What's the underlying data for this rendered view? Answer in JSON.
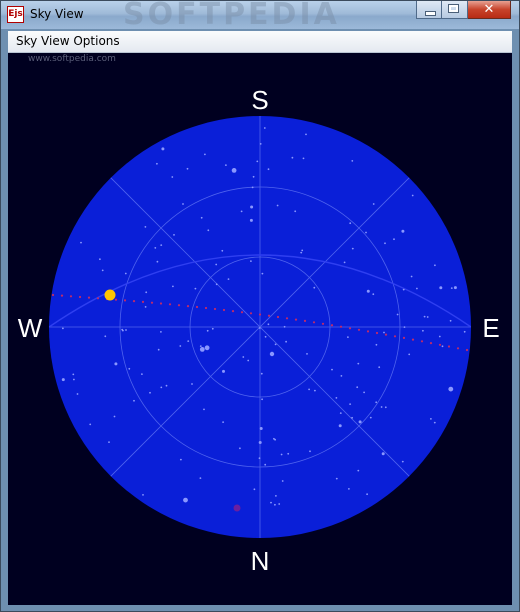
{
  "window": {
    "title": "Sky View",
    "icon": "Ejs",
    "watermark": "SOFTPEDIA",
    "buttons": [
      "minimize-icon",
      "maximize-icon",
      "close-icon"
    ]
  },
  "menu": {
    "items": [
      "Sky View Options"
    ]
  },
  "content": {
    "url_watermark": "www.softpedia.com"
  },
  "sky": {
    "directions": {
      "top": "S",
      "bottom": "N",
      "left": "W",
      "right": "E"
    },
    "colors": {
      "background": "#000020",
      "disc": "#0a1fd8",
      "grid": "#4f63ee",
      "stars": "#8a97ff",
      "ecliptic": "#c02a6a",
      "sun": "#ffc400",
      "planet": "#6a1fa0",
      "label": "#ffffff"
    }
  }
}
